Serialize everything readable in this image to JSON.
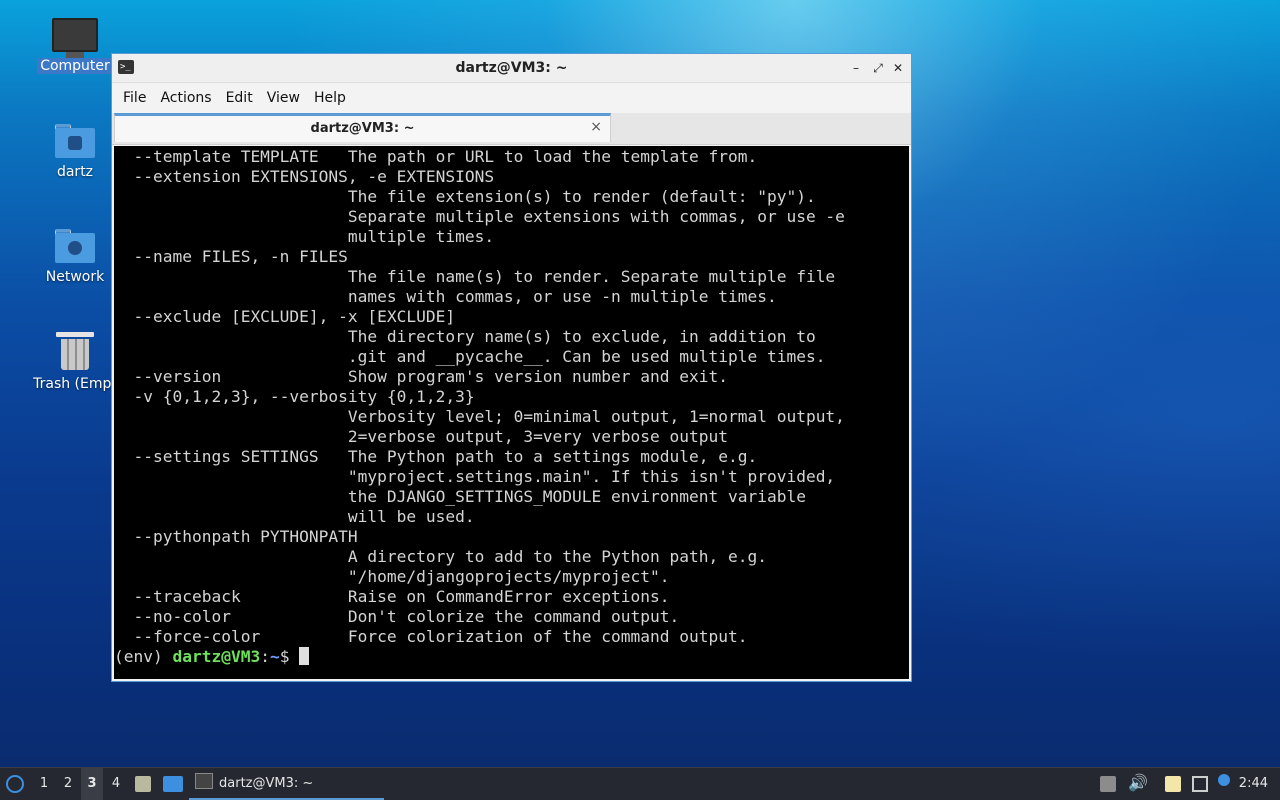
{
  "desktop": {
    "icons": [
      {
        "label": "Computer"
      },
      {
        "label": "dartz"
      },
      {
        "label": "Network"
      },
      {
        "label": "Trash (Empt"
      }
    ]
  },
  "window": {
    "title": "dartz@VM3: ~",
    "controls": {
      "minimize": "–",
      "maximize": "⤢",
      "close": "✕"
    },
    "menu": [
      "File",
      "Actions",
      "Edit",
      "View",
      "Help"
    ],
    "tab": {
      "label": "dartz@VM3: ~",
      "close": "×"
    }
  },
  "terminal": {
    "lines": [
      "  --template TEMPLATE   The path or URL to load the template from.",
      "  --extension EXTENSIONS, -e EXTENSIONS",
      "                        The file extension(s) to render (default: \"py\").",
      "                        Separate multiple extensions with commas, or use -e",
      "                        multiple times.",
      "  --name FILES, -n FILES",
      "                        The file name(s) to render. Separate multiple file",
      "                        names with commas, or use -n multiple times.",
      "  --exclude [EXCLUDE], -x [EXCLUDE]",
      "                        The directory name(s) to exclude, in addition to",
      "                        .git and __pycache__. Can be used multiple times.",
      "  --version             Show program's version number and exit.",
      "  -v {0,1,2,3}, --verbosity {0,1,2,3}",
      "                        Verbosity level; 0=minimal output, 1=normal output,",
      "                        2=verbose output, 3=very verbose output",
      "  --settings SETTINGS   The Python path to a settings module, e.g.",
      "                        \"myproject.settings.main\". If this isn't provided,",
      "                        the DJANGO_SETTINGS_MODULE environment variable",
      "                        will be used.",
      "  --pythonpath PYTHONPATH",
      "                        A directory to add to the Python path, e.g.",
      "                        \"/home/djangoprojects/myproject\".",
      "  --traceback           Raise on CommandError exceptions.",
      "  --no-color            Don't colorize the command output.",
      "  --force-color         Force colorization of the command output."
    ],
    "prompt": {
      "env": "(env) ",
      "user": "dartz@VM3",
      "sep": ":",
      "path": "~",
      "symbol": "$ "
    }
  },
  "taskbar": {
    "workspaces": [
      "1",
      "2",
      "3",
      "4"
    ],
    "active_workspace": "3",
    "task_label": "dartz@VM3: ~",
    "clock": "2:44"
  },
  "colors": {
    "accent": "#5b9bd5",
    "prompt_user": "#6ee05a",
    "prompt_path": "#6fa0ff"
  }
}
